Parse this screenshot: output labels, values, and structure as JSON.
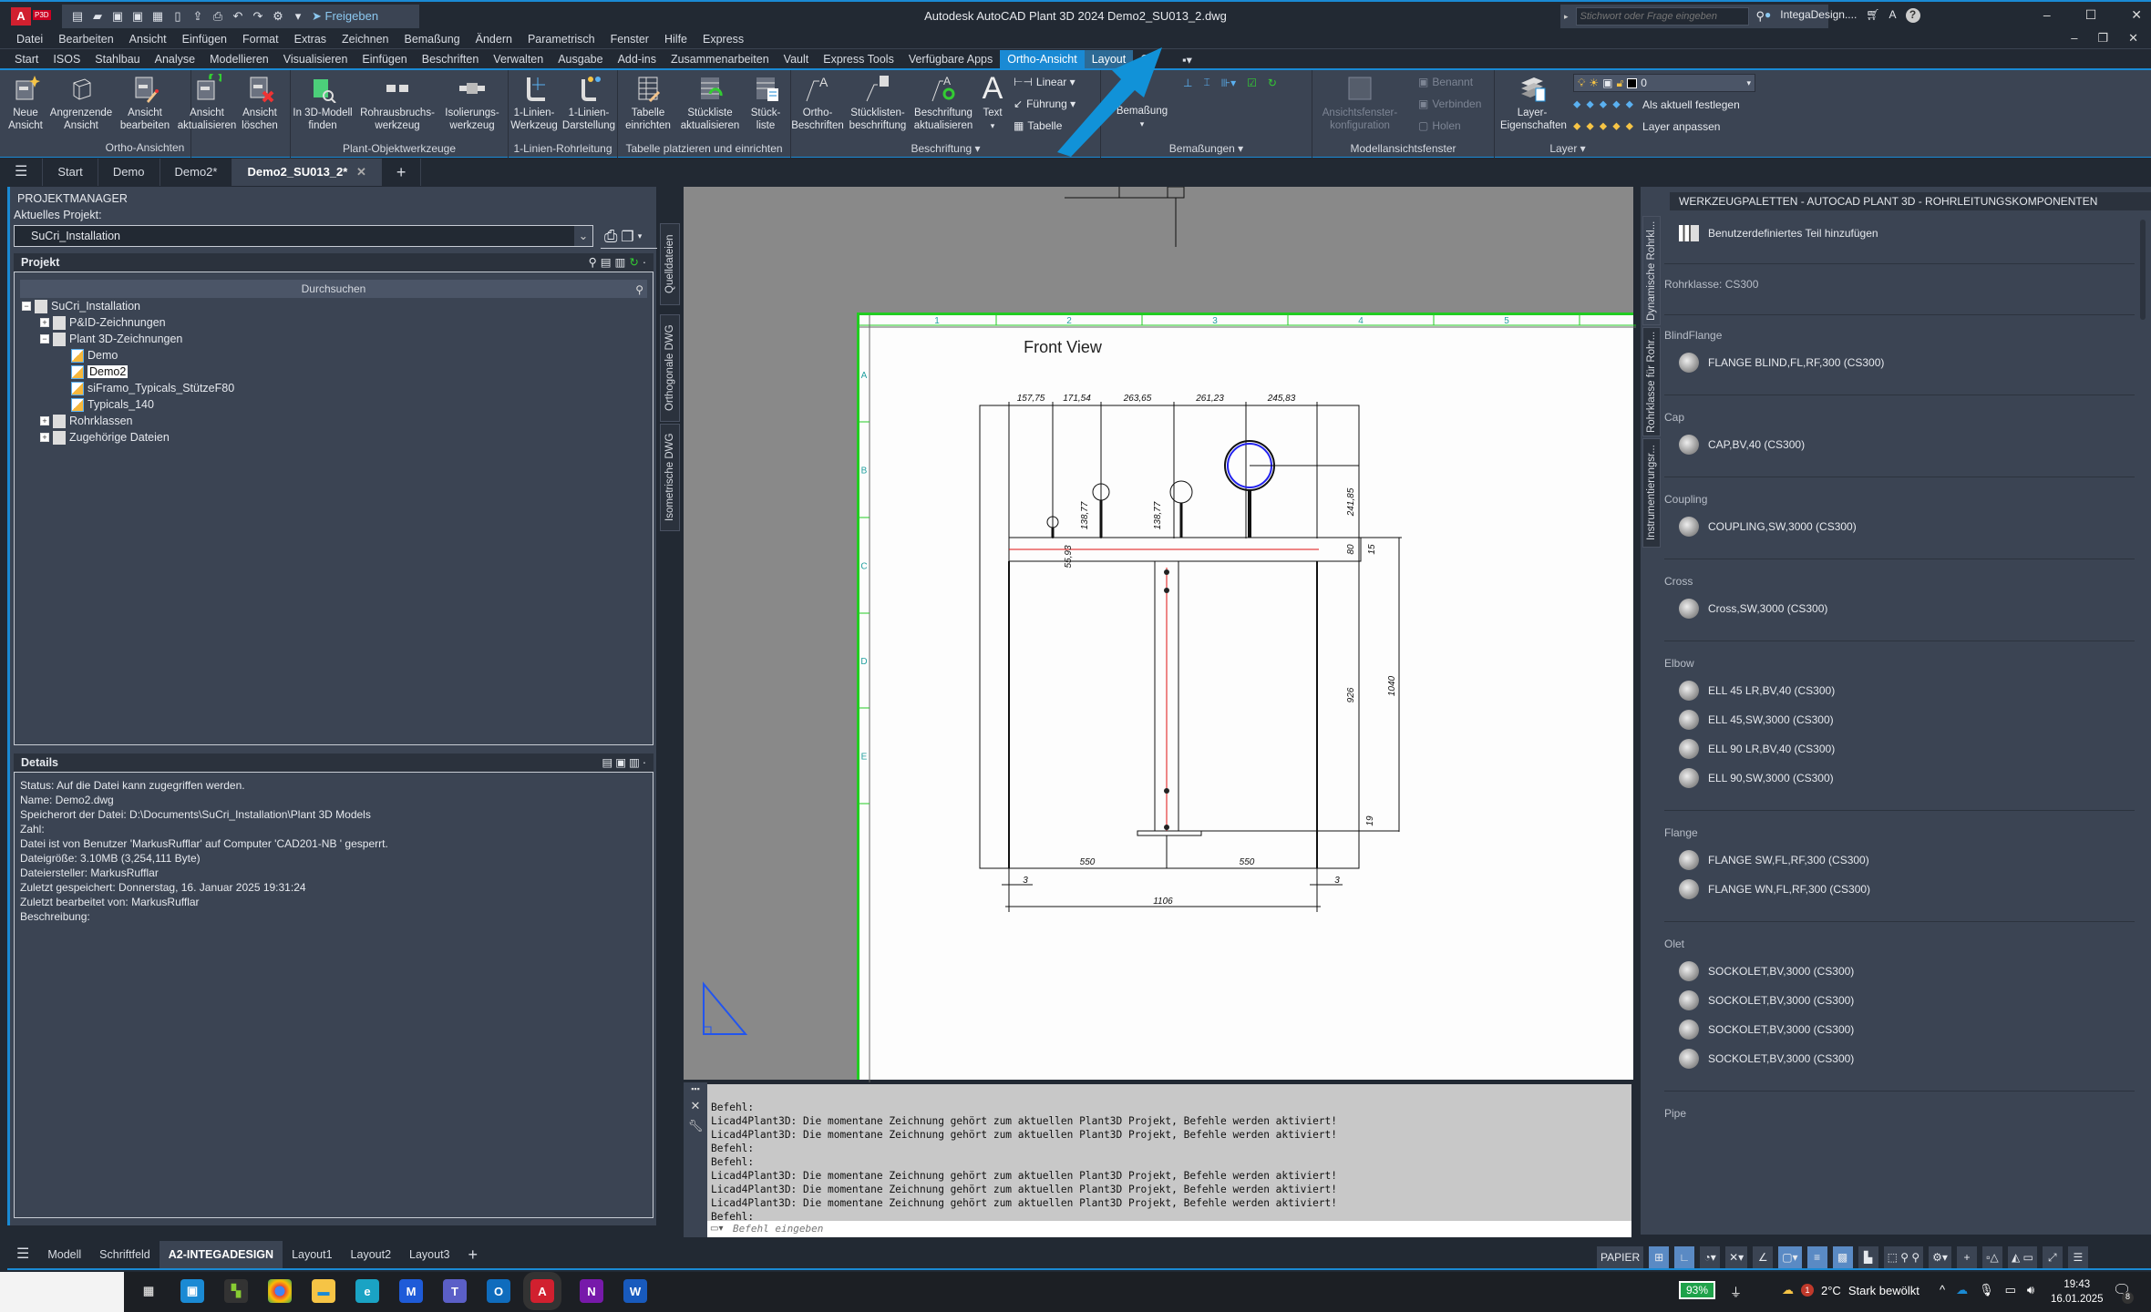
{
  "titlebar": {
    "app_logo": "A",
    "app_tag": "P3D",
    "share_label": "Freigeben",
    "title": "Autodesk AutoCAD Plant 3D 2024    Demo2_SU013_2.dwg",
    "search_placeholder": "Stichwort oder Frage eingeben",
    "user": "IntegaDesign....",
    "minimize": "–",
    "maximize": "☐",
    "close": "✕"
  },
  "menubar": [
    "Datei",
    "Bearbeiten",
    "Ansicht",
    "Einfügen",
    "Format",
    "Extras",
    "Zeichnen",
    "Bemaßung",
    "Ändern",
    "Parametrisch",
    "Fenster",
    "Hilfe",
    "Express"
  ],
  "ribbon_tabs": [
    "Start",
    "ISOS",
    "Stahlbau",
    "Analyse",
    "Modellieren",
    "Visualisieren",
    "Einfügen",
    "Beschriften",
    "Verwalten",
    "Ausgabe",
    "Add-ins",
    "Zusammenarbeiten",
    "Vault",
    "Express Tools",
    "Verfügbare Apps",
    "Ortho-Ansicht",
    "Layout",
    "Cri"
  ],
  "ribbon": {
    "panels": [
      {
        "label": "Ortho-Ansichten",
        "buttons": [
          "Neue\nAnsicht",
          "Angrenzende\nAnsicht",
          "Ansicht\nbearbeiten",
          "Ansicht\naktualisieren",
          "Ansicht\nlöschen"
        ]
      },
      {
        "label": "Plant-Objektwerkzeuge",
        "buttons": [
          "In 3D-Modell\nfinden",
          "Rohrausbruchs-\nwerkzeug",
          "Isolierungs-\nwerkzeug"
        ]
      },
      {
        "label": "1-Linien-Rohrleitung",
        "buttons": [
          "1-Linien-\nWerkzeug",
          "1-Linien-\nDarstellung"
        ]
      },
      {
        "label": "Tabelle platzieren und einrichten",
        "buttons": [
          "Tabelle\neinrichten",
          "Stückliste\naktualisieren",
          "Stück-\nliste"
        ]
      },
      {
        "label": "Beschriftung ▾",
        "buttons": [
          "Ortho-\nBeschriften",
          "Stücklisten-\nbeschriftung",
          "Beschriftung\naktualisieren",
          "Text"
        ],
        "small": [
          "Linear ▾",
          "Führung ▾",
          "Tabelle"
        ]
      },
      {
        "label": "Bemaßungen ▾",
        "buttons": [
          "Bemaßung"
        ]
      },
      {
        "label": "Modellansichtsfenster",
        "buttons": [
          "Ansichtsfenster-\nkonfiguration"
        ],
        "small": [
          "Benannt",
          "Verbinden",
          "Holen"
        ]
      },
      {
        "label": "Layer ▾",
        "buttons": [
          "Layer-\nEigenschaften"
        ],
        "layer_current": "0",
        "small": [
          "Als aktuell festlegen",
          "Layer anpassen"
        ]
      }
    ]
  },
  "doc_tabs": [
    "Start",
    "Demo",
    "Demo2*",
    "Demo2_SU013_2*"
  ],
  "active_doc_tab": "Demo2_SU013_2*",
  "project_manager": {
    "title": "PROJEKTMANAGER",
    "current_project_label": "Aktuelles Projekt:",
    "current_project": "SuCri_Installation",
    "project_header": "Projekt",
    "search_label": "Durchsuchen",
    "tree": [
      {
        "label": "SuCri_Installation",
        "level": 0,
        "exp": "−"
      },
      {
        "label": "P&ID-Zeichnungen",
        "level": 1,
        "exp": "+"
      },
      {
        "label": "Plant 3D-Zeichnungen",
        "level": 1,
        "exp": "−"
      },
      {
        "label": "Demo",
        "level": 2
      },
      {
        "label": "Demo2",
        "level": 2,
        "selected": true
      },
      {
        "label": "siFramo_Typicals_StützeF80",
        "level": 2
      },
      {
        "label": "Typicals_140",
        "level": 2
      },
      {
        "label": "Rohrklassen",
        "level": 1,
        "exp": "+"
      },
      {
        "label": "Zugehörige Dateien",
        "level": 1,
        "exp": "+"
      }
    ],
    "details_header": "Details",
    "details": [
      "Status: Auf die Datei kann zugegriffen werden.",
      "Name:  Demo2.dwg",
      "Speicherort der Datei:  D:\\Documents\\SuCri_Installation\\Plant 3D Models",
      "Zahl:",
      "Datei ist von Benutzer 'MarkusRufflar' auf Computer 'CAD201-NB ' gesperrt.",
      "Dateigröße: 3.10MB (3,254,111 Byte)",
      "Dateiersteller:  MarkusRufflar",
      "Zuletzt gespeichert: Donnerstag, 16. Januar 2025 19:31:24",
      "Zuletzt bearbeitet von:  MarkusRufflar",
      "Beschreibung:"
    ],
    "side_tabs": [
      "Quelldateien",
      "Orthogonale DWG",
      "Isometrische DWG"
    ]
  },
  "drawing": {
    "view_title": "Front View",
    "col_labels": [
      "1",
      "2",
      "3",
      "4",
      "5"
    ],
    "row_labels": [
      "A",
      "B",
      "C",
      "D",
      "E"
    ],
    "dims_top": [
      "157,75",
      "171,54",
      "263,65",
      "261,23",
      "245,83"
    ],
    "dims_vertical": [
      "138,77",
      "138,77",
      "241,85",
      "55,93",
      "80",
      "15",
      "926",
      "1040",
      "19"
    ],
    "dims_bottom": [
      "550",
      "550",
      "3",
      "3",
      "1106"
    ]
  },
  "command": {
    "history": [
      "Befehl:",
      "Licad4Plant3D: Die momentane Zeichnung gehört zum aktuellen Plant3D Projekt, Befehle werden aktiviert!",
      "Licad4Plant3D: Die momentane Zeichnung gehört zum aktuellen Plant3D Projekt, Befehle werden aktiviert!",
      "Befehl:",
      "Befehl:",
      "Licad4Plant3D: Die momentane Zeichnung gehört zum aktuellen Plant3D Projekt, Befehle werden aktiviert!",
      "Licad4Plant3D: Die momentane Zeichnung gehört zum aktuellen Plant3D Projekt, Befehle werden aktiviert!",
      "Licad4Plant3D: Die momentane Zeichnung gehört zum aktuellen Plant3D Projekt, Befehle werden aktiviert!",
      "Befehl:"
    ],
    "placeholder": "Befehl eingeben"
  },
  "palette": {
    "title": "WERKZEUGPALETTEN - AUTOCAD PLANT 3D - ROHRLEITUNGSKOMPONENTEN",
    "side_tabs": [
      "Dynamische Rohrkl...",
      "Rohrklasse für Rohr...",
      "Instrumentierungsr..."
    ],
    "custom_part": "Benutzerdefiniertes Teil hinzufügen",
    "pipe_class": "Rohrklasse: CS300",
    "sections": [
      {
        "name": "BlindFlange",
        "items": [
          "FLANGE BLIND,FL,RF,300 (CS300)"
        ]
      },
      {
        "name": "Cap",
        "items": [
          "CAP,BV,40 (CS300)"
        ]
      },
      {
        "name": "Coupling",
        "items": [
          "COUPLING,SW,3000 (CS300)"
        ]
      },
      {
        "name": "Cross",
        "items": [
          "Cross,SW,3000 (CS300)"
        ]
      },
      {
        "name": "Elbow",
        "items": [
          "ELL 45 LR,BV,40 (CS300)",
          "ELL 45,SW,3000 (CS300)",
          "ELL 90 LR,BV,40 (CS300)",
          "ELL 90,SW,3000 (CS300)"
        ]
      },
      {
        "name": "Flange",
        "items": [
          "FLANGE SW,FL,RF,300 (CS300)",
          "FLANGE WN,FL,RF,300 (CS300)"
        ]
      },
      {
        "name": "Olet",
        "items": [
          "SOCKOLET,BV,3000 (CS300)",
          "SOCKOLET,BV,3000 (CS300)",
          "SOCKOLET,BV,3000 (CS300)",
          "SOCKOLET,BV,3000 (CS300)"
        ]
      },
      {
        "name": "Pipe",
        "items": []
      }
    ]
  },
  "layout_tabs": [
    "Modell",
    "Schriftfeld",
    "A2-INTEGADESIGN",
    "Layout1",
    "Layout2",
    "Layout3"
  ],
  "active_layout": "A2-INTEGADESIGN",
  "status": {
    "space": "PAPIER"
  },
  "taskbar": {
    "battery": "93%",
    "weather_temp": "2°C",
    "weather_text": "Stark bewölkt",
    "weather_badge": "1",
    "time": "19:43",
    "date": "16.01.2025",
    "notif_count": "8"
  },
  "colors": {
    "accent": "#1a8ad4",
    "panel": "#3b4453",
    "dark": "#222933",
    "sheet_border": "#22cc22"
  }
}
